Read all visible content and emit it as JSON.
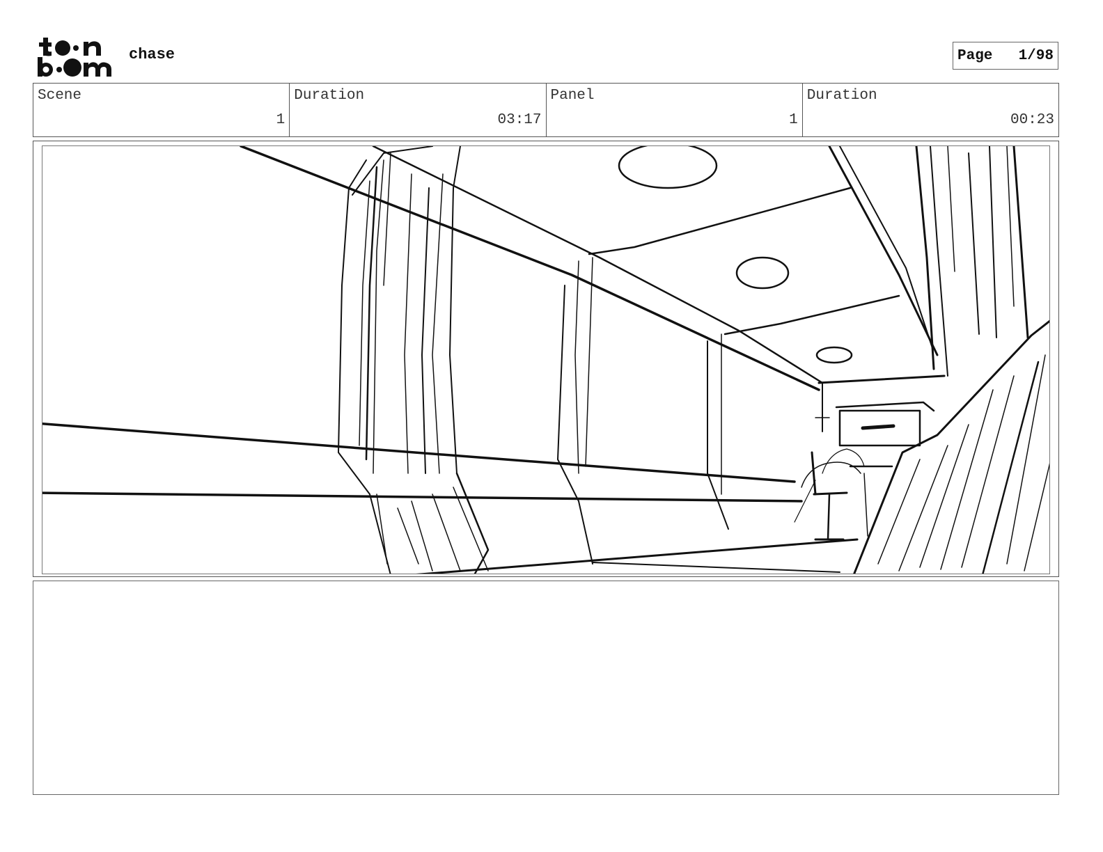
{
  "header": {
    "logo_text": "toonboom",
    "project_title": "chase",
    "page_label": "Page",
    "page_number": "1/98"
  },
  "info": {
    "scene_label": "Scene",
    "scene_value": "1",
    "scene_duration_label": "Duration",
    "scene_duration_value": "03:17",
    "panel_label": "Panel",
    "panel_value": "1",
    "panel_duration_label": "Duration",
    "panel_duration_value": "00:23"
  },
  "notes": {
    "text": ""
  }
}
